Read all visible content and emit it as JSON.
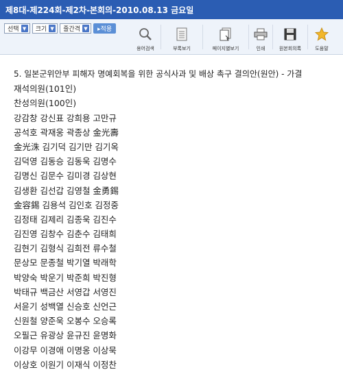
{
  "title": "제8대-제224회-제2차-본회의-2010.08.13 금요일",
  "toolbar": {
    "select_label": "선택",
    "size_label": "크기",
    "line_spacing_label": "줄간격",
    "apply_label": "▸적용",
    "tools": [
      {
        "label": "용어검색",
        "icon": "search-icon"
      },
      {
        "label": "부록보기",
        "icon": "document-icon"
      },
      {
        "label": "페이지별보기",
        "icon": "pages-icon"
      },
      {
        "label": "인쇄",
        "icon": "print-icon"
      },
      {
        "label": "원본회의록",
        "icon": "save-icon"
      },
      {
        "label": "도움말",
        "icon": "star-icon"
      }
    ]
  },
  "content": {
    "heading": "5. 일본군위안부 피해자 명예회복을 위한 공식사과 및 배상 촉구 결의안(원안) - 가결",
    "present": "재석의원(101인)",
    "approve": "찬성의원(100인)",
    "names": [
      "강감창 강신표 강희용 고만규",
      "공석호 곽재웅 곽종상 金光壽",
      "金光洙 김기덕 김기만 김기옥",
      "김덕영 김동승 김동욱 김명수",
      "김명신 김문수 김미경 김상현",
      "김생환 김선갑 김영철 金勇錫",
      "金容錫 김용석 김인호 김정중",
      "김정태 김제리 김종욱 김진수",
      "김진영 김창수 김춘수 김태희",
      "김현기 김형식 김희전 류수철",
      "문상모 문종철 박기열 박래학",
      "박양숙 박운기 박준희 박진형",
      "박태규 백금산 서영갑 서영진",
      "서윤기 성백열 신승호 신언근",
      "신원철 양준욱 오봉수 오승록",
      "오필근 유광상 윤규진 윤명화",
      "이강무 이경애 이명옹 이상묵",
      "이상호 이원기 이재식 이정찬"
    ]
  }
}
